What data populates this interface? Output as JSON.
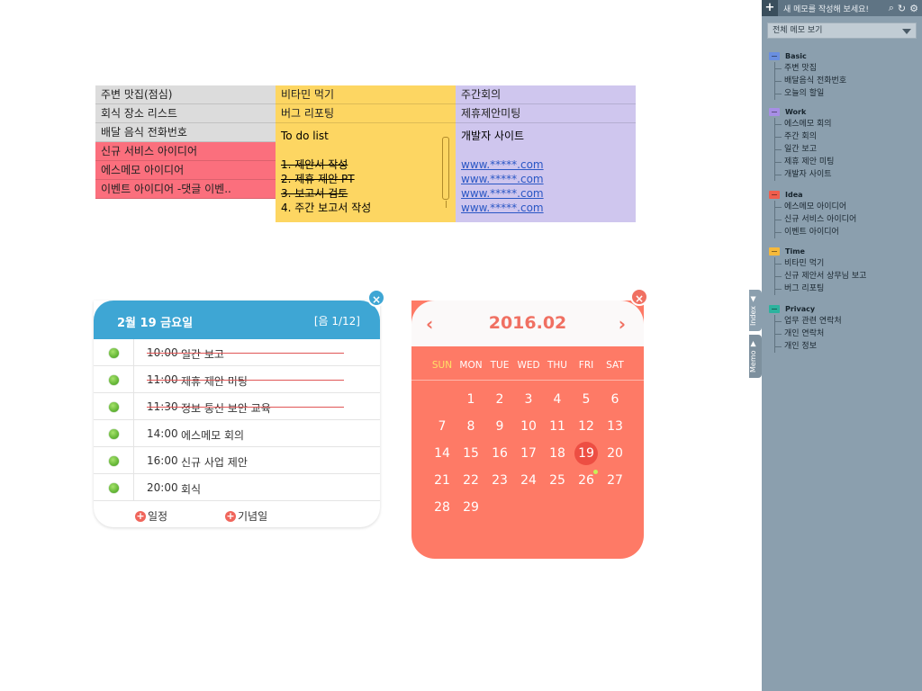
{
  "memo": {
    "col1": [
      "주변 맛집(점심)",
      "회식 장소 리스트",
      "배달 음식 전화번호",
      "신규 서비스 아이디어",
      "에스메모 아이디어",
      "이벤트 아이디어 -댓글 이벤.."
    ],
    "col2_top": [
      "비타민 먹기",
      "버그 리포팅"
    ],
    "todo": {
      "title": "To do list",
      "items": [
        "1. 제안서 작성",
        "2. 제휴 제안 PT",
        "3. 보고서 검토",
        "4. 주간 보고서 작성"
      ]
    },
    "col3_top": [
      "주간회의",
      "제휴제안미팅"
    ],
    "dev": {
      "title": "개발자 사이트",
      "links": [
        "www.*****.com",
        "www.*****.com",
        "www.*****.com",
        "www.*****.com"
      ]
    }
  },
  "schedule": {
    "date": "2월 19 금요일",
    "lunar": "[음 1/12]",
    "close": "×",
    "rows": [
      {
        "time": "10:00",
        "text": "일간 보고",
        "done": true
      },
      {
        "time": "11:00",
        "text": "제휴 제안 미팅",
        "done": true
      },
      {
        "time": "11:30",
        "text": "정보 통신 보안 교육",
        "done": true
      },
      {
        "time": "14:00",
        "text": "에스메모 회의",
        "done": false
      },
      {
        "time": "16:00",
        "text": "신규 사업 제안",
        "done": false
      },
      {
        "time": "20:00",
        "text": "회식",
        "done": false
      }
    ],
    "add_event": "일정",
    "add_anniv": "기념일"
  },
  "calendar": {
    "title": "2016.02",
    "prev": "‹",
    "next": "›",
    "close": "×",
    "weekdays": [
      "SUN",
      "MON",
      "TUE",
      "WED",
      "THU",
      "FRI",
      "SAT"
    ],
    "weeks": [
      [
        "",
        "1",
        "2",
        "3",
        "4",
        "5",
        "6"
      ],
      [
        "7",
        "8",
        "9",
        "10",
        "11",
        "12",
        "13"
      ],
      [
        "14",
        "15",
        "16",
        "17",
        "18",
        "19",
        "20"
      ],
      [
        "21",
        "22",
        "23",
        "24",
        "25",
        "26",
        "27"
      ],
      [
        "28",
        "29",
        "",
        "",
        "",
        "",
        ""
      ]
    ],
    "today": "19",
    "marked": "26",
    "colors": {
      "bg": "#fe7a66",
      "today": "#ed4e43",
      "sunday": "#ffe066"
    }
  },
  "sidebar": {
    "plus": "+",
    "new_memo": "새 메모를 작성해 보세요!",
    "icons": [
      "search-icon",
      "refresh-icon",
      "gear-icon"
    ],
    "view_all": "전체 메모 보기",
    "categories": [
      {
        "name": "Basic",
        "color": "#6a8fe0",
        "items": [
          "주변 맛집",
          "배달음식 전화번호",
          "오늘의 할일"
        ]
      },
      {
        "name": "Work",
        "color": "#a78ee6",
        "items": [
          "에스메모 회의",
          "주간 회의",
          "일간 보고",
          "제휴 제안 미팅",
          "개발자 사이트"
        ]
      },
      {
        "name": "Idea",
        "color": "#ef5e4e",
        "items": [
          "에스메모 아이디어",
          "신규 서비스 아이디어",
          "이벤트 아이디어"
        ]
      },
      {
        "name": "Time",
        "color": "#f6b93a",
        "items": [
          "비타민 먹기",
          "신규 제안서 상무님 보고",
          "버그 리포팅"
        ]
      },
      {
        "name": "Privacy",
        "color": "#2db39e",
        "items": [
          "업무 관련 연락처",
          "개인 연락처",
          "개인 정보"
        ]
      }
    ],
    "tabs": [
      "Index ▲",
      "Memo ▼"
    ]
  }
}
